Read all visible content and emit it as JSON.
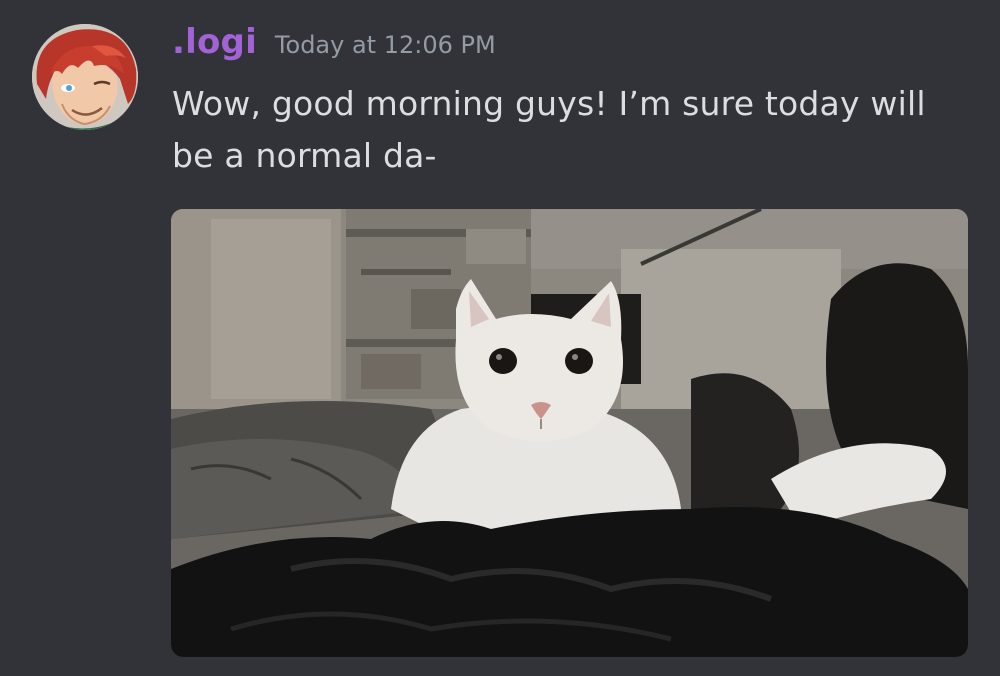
{
  "message": {
    "author": ".logi",
    "timestamp": "Today at 12:06 PM",
    "content": "Wow, good morning guys! I’m sure today will be a normal da-",
    "attachment_icon": "cat-photo"
  },
  "colors": {
    "background": "#313338",
    "username": "#a362d6",
    "timestamp": "#949ba4",
    "text": "#dbdee1"
  }
}
